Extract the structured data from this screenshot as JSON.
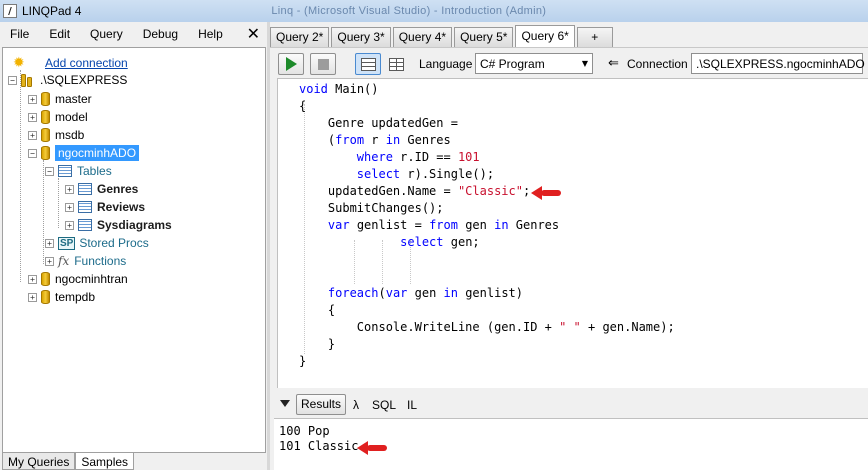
{
  "app": {
    "title": "LINQPad 4",
    "app_icon_glyph": "/",
    "window_title_tail": "Linq - (Microsoft Visual Studio) - Introduction (Admin)"
  },
  "menu": {
    "items": [
      "File",
      "Edit",
      "Query",
      "Debug",
      "Help"
    ],
    "close_glyph": "✕"
  },
  "tree": {
    "add_connection": "Add connection",
    "server": ".\\SQLEXPRESS",
    "databases": [
      {
        "name": "master",
        "expander": "+"
      },
      {
        "name": "model",
        "expander": "+"
      },
      {
        "name": "msdb",
        "expander": "+"
      },
      {
        "name": "ngocminhADO",
        "expander": "−",
        "selected": true
      }
    ],
    "tables_folder": "Tables",
    "tables": [
      "Genres",
      "Reviews",
      "Sysdiagrams"
    ],
    "stored_procs": "Stored Procs",
    "functions": "Functions",
    "more_databases": [
      "ngocminhtran",
      "tempdb"
    ],
    "sp_glyph": "SP",
    "fx_glyph": "fx",
    "sun_glyph": "✹"
  },
  "left_tabs": [
    "My Queries",
    "Samples"
  ],
  "query_tabs": [
    {
      "label": "Query 2*",
      "active": false
    },
    {
      "label": "Query 3*",
      "active": false
    },
    {
      "label": "Query 4*",
      "active": false
    },
    {
      "label": "Query 5*",
      "active": false
    },
    {
      "label": "Query 6*",
      "active": true
    },
    {
      "label": "+",
      "active": false
    }
  ],
  "toolbar": {
    "language_label": "Language",
    "language_value": "C# Program",
    "connection_label": "Connection",
    "connection_value": ".\\SQLEXPRESS.ngocminhADO",
    "connection_arrow": "⇐",
    "dropdown_arrow": "▼"
  },
  "code": {
    "line1": "Main()",
    "line1_kw": "void",
    "line2": "{",
    "line3": "Genre updatedGen =",
    "line4_a": "(",
    "line4_kw1": "from",
    "line4_b": " r ",
    "line4_kw2": "in",
    "line4_c": " Genres",
    "line5_kw": "where",
    "line5_a": " r.ID == ",
    "line5_num": "101",
    "line6_kw": "select",
    "line6_a": " r).Single();",
    "line7_a": "updatedGen.Name = ",
    "line7_str": "\"Classic\"",
    "line7_b": ";",
    "line8": "SubmitChanges();",
    "line9_kw1": "var",
    "line9_a": " genlist = ",
    "line9_kw2": "from",
    "line9_b": " gen ",
    "line9_kw3": "in",
    "line9_c": " Genres",
    "line10_kw": "select",
    "line10_a": " gen;",
    "line11_kw1": "foreach",
    "line11_a": "(",
    "line11_kw2": "var",
    "line11_b": " gen ",
    "line11_kw3": "in",
    "line11_c": " genlist)",
    "line12": "{",
    "line13_a": "Console.WriteLine (gen.ID + ",
    "line13_str": "\" \"",
    "line13_b": " + gen.Name);",
    "line14": "}",
    "line15": "}"
  },
  "results": {
    "tabs": [
      "Results",
      "λ",
      "SQL",
      "IL"
    ],
    "lines": [
      "100 Pop",
      "101 Classic"
    ]
  },
  "colors": {
    "keyword": "#0000ff",
    "string": "#c8102e",
    "annotation_arrow": "#e02020",
    "selection": "#3399ff"
  }
}
